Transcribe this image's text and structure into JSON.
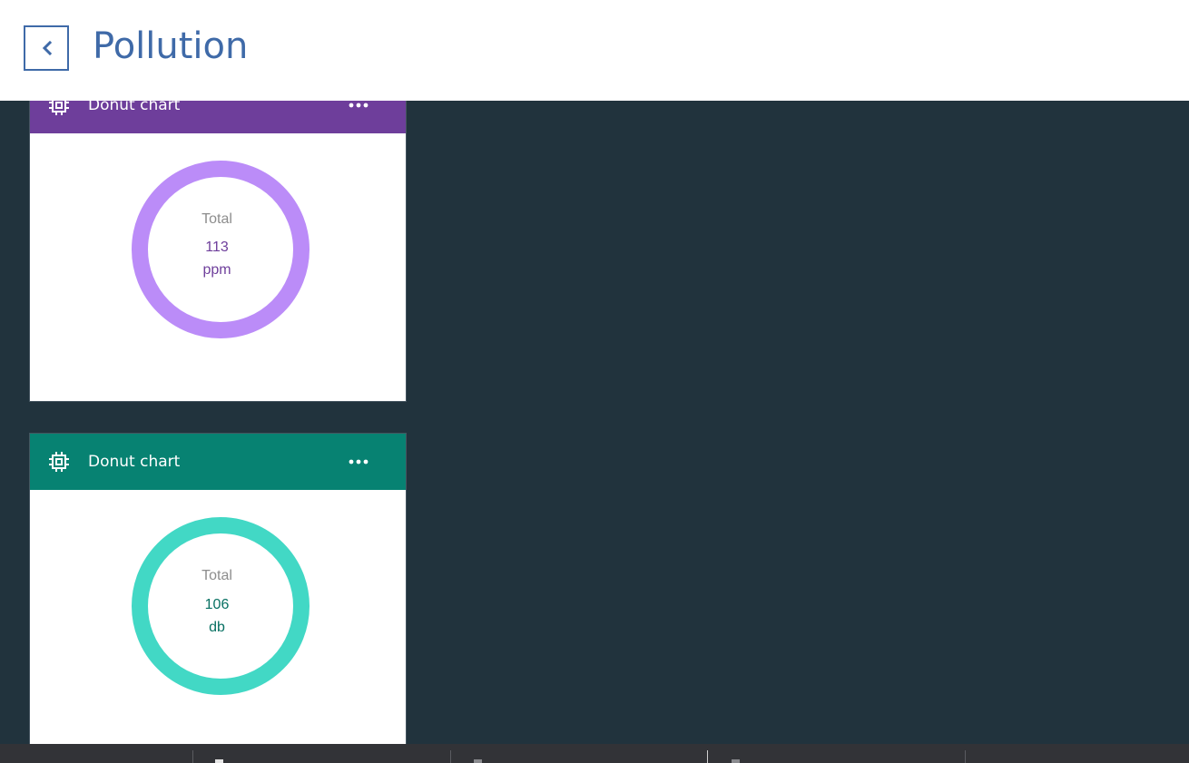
{
  "header": {
    "title": "Pollution"
  },
  "cards": [
    {
      "title": "Donut chart",
      "header_color": "#6e3e9b",
      "ring_color": "#bb8cf8",
      "value_color": "#6e3e9b",
      "total_label": "Total",
      "value": "113",
      "unit": "ppm",
      "icon": "chip-icon",
      "menu_icon": "overflow-menu-icon"
    },
    {
      "title": "Donut chart",
      "header_color": "#078272",
      "ring_color": "#42d8c5",
      "value_color": "#077062",
      "total_label": "Total",
      "value": "106",
      "unit": "db",
      "icon": "chip-icon",
      "menu_icon": "overflow-menu-icon"
    }
  ],
  "colors": {
    "background": "#21333d",
    "accent": "#3f6aa8",
    "taskbar": "#323337"
  }
}
